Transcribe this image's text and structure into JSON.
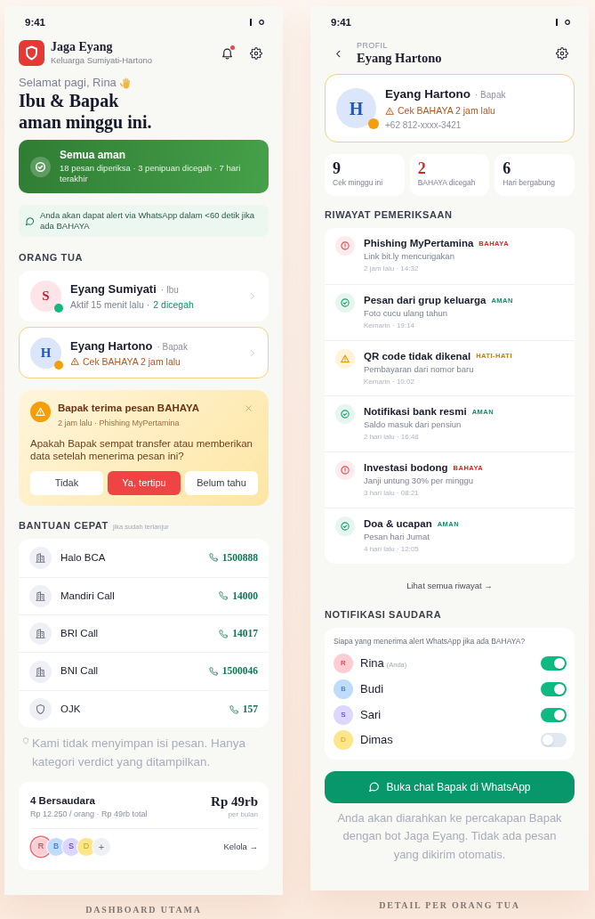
{
  "dashboard": {
    "status_bar": {
      "time": "9:41"
    },
    "app": {
      "title": "Jaga Eyang",
      "subtitle": "Keluarga Sumiyati-Hartono",
      "has_unread": true
    },
    "greeting": "Selamat pagi, Rina",
    "headline": [
      "Ibu & Bapak",
      "aman minggu ini."
    ],
    "summary": {
      "kind": "safe",
      "title": "Semua aman",
      "text": "18 pesan diperiksa · 3 penipuan dicegah · 7 hari terakhir"
    },
    "info": "Anda akan dapat alert via WhatsApp dalam <60 detik jika ada BAHAYA",
    "parents_heading": "ORANG TUA",
    "parents": [
      {
        "initial": "S",
        "color": "#fde4e8",
        "name": "Eyang Sumiyati",
        "role": "· Ibu",
        "kind": "ok",
        "status": [
          {
            "text": "Aktif 15 menit lalu ·",
            "kind": "muted"
          },
          {
            "text": "2 dicegah",
            "kind": "good"
          }
        ]
      },
      {
        "initial": "H",
        "color": "#dbe6fb",
        "name": "Eyang Hartono",
        "role": "· Bapak",
        "kind": "warning",
        "status": [
          {
            "text": "Cek BAHAYA 2 jam lalu",
            "kind": "warning"
          }
        ]
      }
    ],
    "alert": {
      "title": "Bapak terima pesan BAHAYA",
      "meta": "2 jam lalu · Phishing MyPertamina",
      "question": "Apakah Bapak sempat transfer atau memberikan data setelah menerima pesan ini?",
      "buttons": [
        {
          "label": "Tidak",
          "kind": "plain"
        },
        {
          "label": "Ya, tertipu",
          "kind": "danger"
        },
        {
          "label": "Belum tahu",
          "kind": "plain"
        }
      ]
    },
    "help_heading": "BANTUAN CEPAT",
    "help_hint": "jika sudah terlanjur",
    "hotlines": [
      {
        "name": "Halo BCA",
        "number": "1500888",
        "kind": "bank"
      },
      {
        "name": "Mandiri Call",
        "number": "14000",
        "kind": "bank"
      },
      {
        "name": "BRI Call",
        "number": "14017",
        "kind": "bank"
      },
      {
        "name": "BNI Call",
        "number": "1500046",
        "kind": "bank"
      },
      {
        "name": "OJK",
        "number": "157",
        "kind": "regulator"
      }
    ],
    "privacy_note": "Kami tidak menyimpan isi pesan. Hanya kategori verdict yang ditampilkan.",
    "plan": {
      "title": "4 Bersaudara",
      "detail": "Rp 12.250 / orang · Rp 49rb total",
      "price": "Rp 49rb",
      "period": "per bulan",
      "members": [
        {
          "initial": "R",
          "color": "#fecdd3",
          "selected": true
        },
        {
          "initial": "B",
          "color": "#bfdbfe",
          "selected": false
        },
        {
          "initial": "S",
          "color": "#ddd6fe",
          "selected": false
        },
        {
          "initial": "D",
          "color": "#fde68a",
          "selected": false
        }
      ],
      "add": "+",
      "manage": "Kelola →"
    },
    "caption": "DASHBOARD UTAMA"
  },
  "detail": {
    "status_bar": {
      "time": "9:41"
    },
    "header": {
      "overline": "PROFIL",
      "title": "Eyang Hartono"
    },
    "profile": {
      "initial": "H",
      "color": "#dbe6fb",
      "name": "Eyang Hartono",
      "role": "· Bapak",
      "kind": "warning",
      "status": "Cek BAHAYA 2 jam lalu",
      "phone": "+62 812-xxxx-3421"
    },
    "stats": [
      {
        "value": "9",
        "label": "Cek minggu ini",
        "kind": "neutral"
      },
      {
        "value": "2",
        "label": "BAHAYA dicegah",
        "kind": "danger"
      },
      {
        "value": "6",
        "label": "Hari bergabung",
        "kind": "neutral"
      }
    ],
    "history_heading": "RIWAYAT PEMERIKSAAN",
    "history": [
      {
        "title": "Phishing MyPertamina",
        "verdict": "BAHAYA",
        "kind": "danger",
        "description": "Link bit.ly mencurigakan",
        "time": "2 jam lalu · 14:32"
      },
      {
        "title": "Pesan dari grup keluarga",
        "verdict": "AMAN",
        "kind": "safe",
        "description": "Foto cucu ulang tahun",
        "time": "Kemarin · 19:14"
      },
      {
        "title": "QR code tidak dikenal",
        "verdict": "HATI-HATI",
        "kind": "warning",
        "description": "Pembayaran dari nomor baru",
        "time": "Kemarin · 10:02"
      },
      {
        "title": "Notifikasi bank resmi",
        "verdict": "AMAN",
        "kind": "safe",
        "description": "Saldo masuk dari pensiun",
        "time": "2 hari lalu · 16:48"
      },
      {
        "title": "Investasi bodong",
        "verdict": "BAHAYA",
        "kind": "danger",
        "description": "Janji untung 30% per minggu",
        "time": "3 hari lalu · 08:21"
      },
      {
        "title": "Doa & ucapan",
        "verdict": "AMAN",
        "kind": "safe",
        "description": "Pesan hari Jumat",
        "time": "4 hari lalu · 12:05"
      }
    ],
    "see_all": "Lihat semua riwayat →",
    "notify_heading": "NOTIFIKASI SAUDARA",
    "notify_prompt": "Siapa yang menerima alert WhatsApp jika ada BAHAYA?",
    "recipients": [
      {
        "initial": "R",
        "color": "#fecdd3",
        "name": "Rina",
        "note": "(Anda)",
        "on": true
      },
      {
        "initial": "B",
        "color": "#bfdbfe",
        "name": "Budi",
        "on": true
      },
      {
        "initial": "S",
        "color": "#ddd6fe",
        "name": "Sari",
        "on": true
      },
      {
        "initial": "D",
        "color": "#fde68a",
        "name": "Dimas",
        "on": false
      }
    ],
    "whatsapp_button": "Buka chat Bapak di WhatsApp",
    "redirect_note": "Anda akan diarahkan ke percakapan Bapak dengan bot Jaga Eyang. Tidak ada pesan yang dikirim otomatis.",
    "caption": "DETAIL PER ORANG TUA"
  }
}
